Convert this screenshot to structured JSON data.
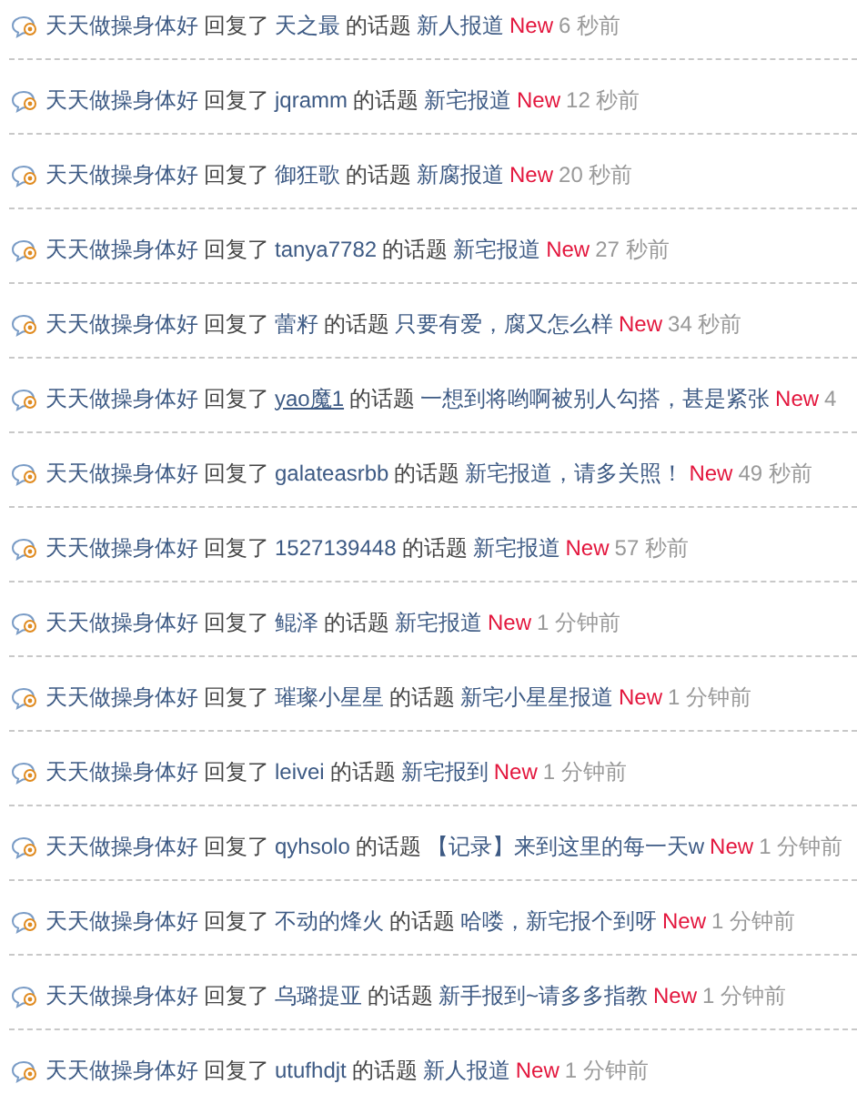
{
  "activity_feed": [
    {
      "actor": "天天做操身体好",
      "verb": "回复了",
      "target_user": "天之最",
      "hovered": false,
      "connector": "的话题",
      "topic": "新人报道",
      "badge": "New",
      "time": "6 秒前"
    },
    {
      "actor": "天天做操身体好",
      "verb": "回复了",
      "target_user": "jqramm",
      "hovered": false,
      "connector": "的话题",
      "topic": "新宅报道",
      "badge": "New",
      "time": "12 秒前"
    },
    {
      "actor": "天天做操身体好",
      "verb": "回复了",
      "target_user": "御狂歌",
      "hovered": false,
      "connector": "的话题",
      "topic": "新腐报道",
      "badge": "New",
      "time": "20 秒前"
    },
    {
      "actor": "天天做操身体好",
      "verb": "回复了",
      "target_user": "tanya7782",
      "hovered": false,
      "connector": "的话题",
      "topic": "新宅报道",
      "badge": "New",
      "time": "27 秒前"
    },
    {
      "actor": "天天做操身体好",
      "verb": "回复了",
      "target_user": "蕾籽",
      "hovered": false,
      "connector": "的话题",
      "topic": "只要有爱，腐又怎么样",
      "badge": "New",
      "time": "34 秒前"
    },
    {
      "actor": "天天做操身体好",
      "verb": "回复了",
      "target_user": "yao魔1",
      "hovered": true,
      "connector": "的话题",
      "topic": "一想到将哟啊被别人勾搭，甚是紧张",
      "badge": "New",
      "time": "4"
    },
    {
      "actor": "天天做操身体好",
      "verb": "回复了",
      "target_user": "galateasrbb",
      "hovered": false,
      "connector": "的话题",
      "topic": "新宅报道，请多关照！",
      "badge": "New",
      "time": "49 秒前"
    },
    {
      "actor": "天天做操身体好",
      "verb": "回复了",
      "target_user": "1527139448",
      "hovered": false,
      "connector": "的话题",
      "topic": "新宅报道",
      "badge": "New",
      "time": "57 秒前"
    },
    {
      "actor": "天天做操身体好",
      "verb": "回复了",
      "target_user": "鲲泽",
      "hovered": false,
      "connector": "的话题",
      "topic": "新宅报道",
      "badge": "New",
      "time": "1 分钟前"
    },
    {
      "actor": "天天做操身体好",
      "verb": "回复了",
      "target_user": "璀璨小星星",
      "hovered": false,
      "connector": "的话题",
      "topic": "新宅小星星报道",
      "badge": "New",
      "time": "1 分钟前"
    },
    {
      "actor": "天天做操身体好",
      "verb": "回复了",
      "target_user": "leivei",
      "hovered": false,
      "connector": "的话题",
      "topic": "新宅报到",
      "badge": "New",
      "time": "1 分钟前"
    },
    {
      "actor": "天天做操身体好",
      "verb": "回复了",
      "target_user": "qyhsolo",
      "hovered": false,
      "connector": "的话题",
      "topic": "【记录】来到这里的每一天w",
      "badge": "New",
      "time": "1 分钟前"
    },
    {
      "actor": "天天做操身体好",
      "verb": "回复了",
      "target_user": "不动的烽火",
      "hovered": false,
      "connector": "的话题",
      "topic": "哈喽，新宅报个到呀",
      "badge": "New",
      "time": "1 分钟前"
    },
    {
      "actor": "天天做操身体好",
      "verb": "回复了",
      "target_user": "乌璐提亚",
      "hovered": false,
      "connector": "的话题",
      "topic": "新手报到~请多多指教",
      "badge": "New",
      "time": "1 分钟前"
    },
    {
      "actor": "天天做操身体好",
      "verb": "回复了",
      "target_user": "utufhdjt",
      "hovered": false,
      "connector": "的话题",
      "topic": "新人报道",
      "badge": "New",
      "time": "1 分钟前"
    }
  ]
}
